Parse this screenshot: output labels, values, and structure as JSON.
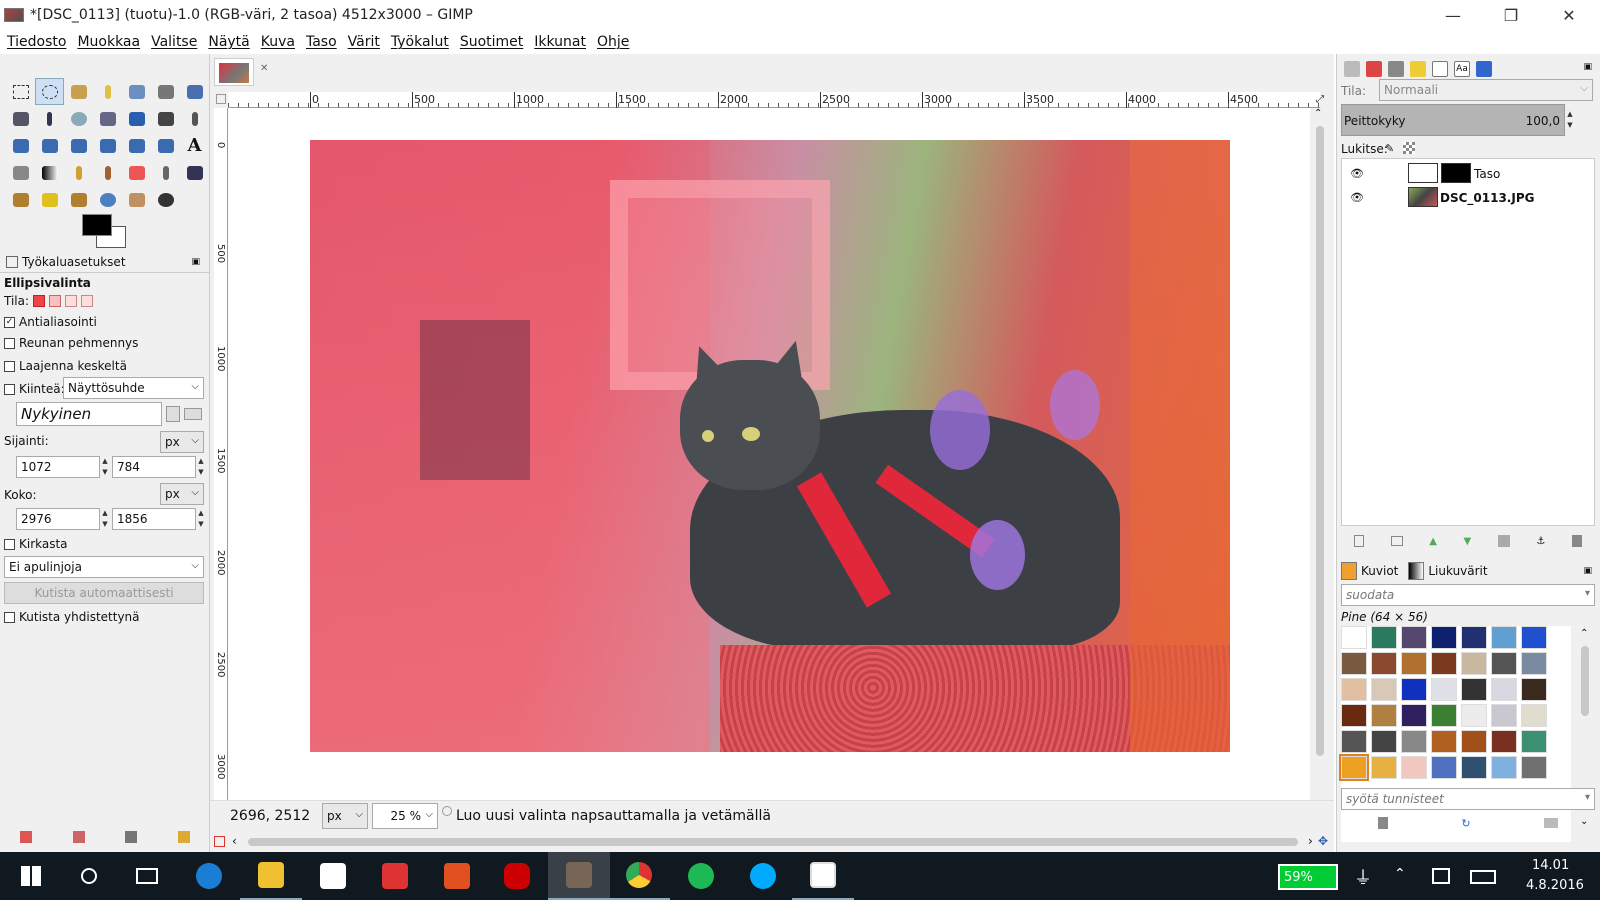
{
  "window": {
    "title": "*[DSC_0113] (tuotu)-1.0 (RGB-väri, 2 tasoa) 4512x3000 – GIMP",
    "minimize": "—",
    "restore": "❐",
    "close": "✕"
  },
  "menu": [
    "Tiedosto",
    "Muokkaa",
    "Valitse",
    "Näytä",
    "Kuva",
    "Taso",
    "Värit",
    "Työkalut",
    "Suotimet",
    "Ikkunat",
    "Ohje"
  ],
  "tool_options": {
    "panel_title": "Työkaluasetukset",
    "tool_name": "Ellipsivalinta",
    "mode_label": "Tila:",
    "antialias": "Antialiasointi",
    "feather": "Reunan pehmennys",
    "expand_center": "Laajenna keskeltä",
    "fixed": "Kiinteä:",
    "fixed_option": "Näyttösuhde",
    "current": "Nykyinen",
    "position_label": "Sijainti:",
    "position_unit": "px",
    "pos_x": "1072",
    "pos_y": "784",
    "size_label": "Koko:",
    "size_unit": "px",
    "size_w": "2976",
    "size_h": "1856",
    "highlight": "Kirkasta",
    "guides": "Ei apulinjoja",
    "auto_shrink": "Kutista automaattisesti",
    "shrink_merged": "Kutista yhdistettynä"
  },
  "ruler": {
    "h_labels": [
      "0",
      "500",
      "1000",
      "1500",
      "2000",
      "2500",
      "3000",
      "3500",
      "4000",
      "4500"
    ],
    "v_labels": [
      "0",
      "500",
      "1000",
      "1500",
      "2000",
      "2500",
      "3000"
    ]
  },
  "status": {
    "coords": "2696, 2512",
    "unit": "px",
    "zoom": "25 %",
    "message": "Luo uusi valinta napsauttamalla ja vetämällä"
  },
  "layers": {
    "mode_label": "Tila:",
    "mode_value": "Normaali",
    "opacity_label": "Peittokyky",
    "opacity_value": "100,0",
    "lock_label": "Lukitse:",
    "items": [
      {
        "name": "Taso",
        "visible": true
      },
      {
        "name": "DSC_0113.JPG",
        "visible": true
      }
    ]
  },
  "patterns": {
    "tab_patterns": "Kuviot",
    "tab_gradients": "Liukuvärit",
    "filter_placeholder": "suodata",
    "selected_name": "Pine (64 × 56)",
    "tags_placeholder": "syötä tunnisteet"
  },
  "taskbar": {
    "battery": "59%",
    "time": "14.01",
    "date": "4.8.2016"
  }
}
